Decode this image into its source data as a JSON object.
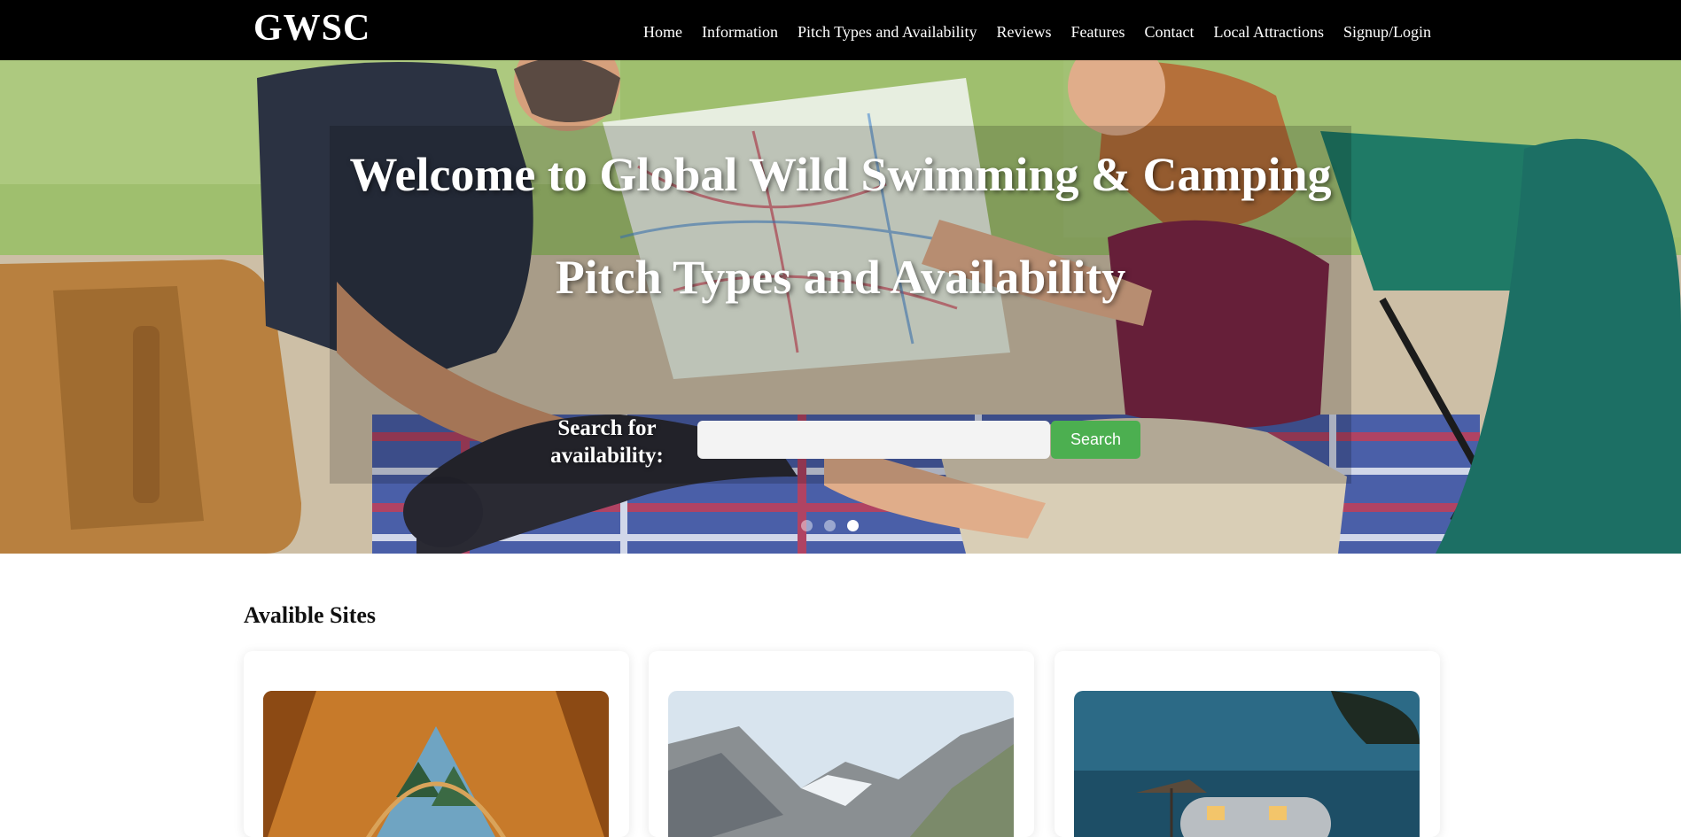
{
  "header": {
    "logo": "GWSC",
    "nav": [
      "Home",
      "Information",
      "Pitch Types and Availability",
      "Reviews",
      "Features",
      "Contact",
      "Local Attractions",
      "Signup/Login"
    ]
  },
  "hero": {
    "title": "Welcome to Global Wild Swimming & Camping",
    "subtitle": "Pitch Types and Availability",
    "search_label": "Search for availability:",
    "search_value": "",
    "search_button": "Search",
    "carousel": {
      "slides": 3,
      "active": 2
    }
  },
  "sites": {
    "heading": "Avalible Sites",
    "cards": [
      {
        "image": "tent-interior-forest-view"
      },
      {
        "image": "mountain-valley"
      },
      {
        "image": "vintage-caravan-at-dusk"
      }
    ]
  },
  "colors": {
    "nav_bg": "#000000",
    "accent": "#4caf50",
    "text": "#111111"
  }
}
